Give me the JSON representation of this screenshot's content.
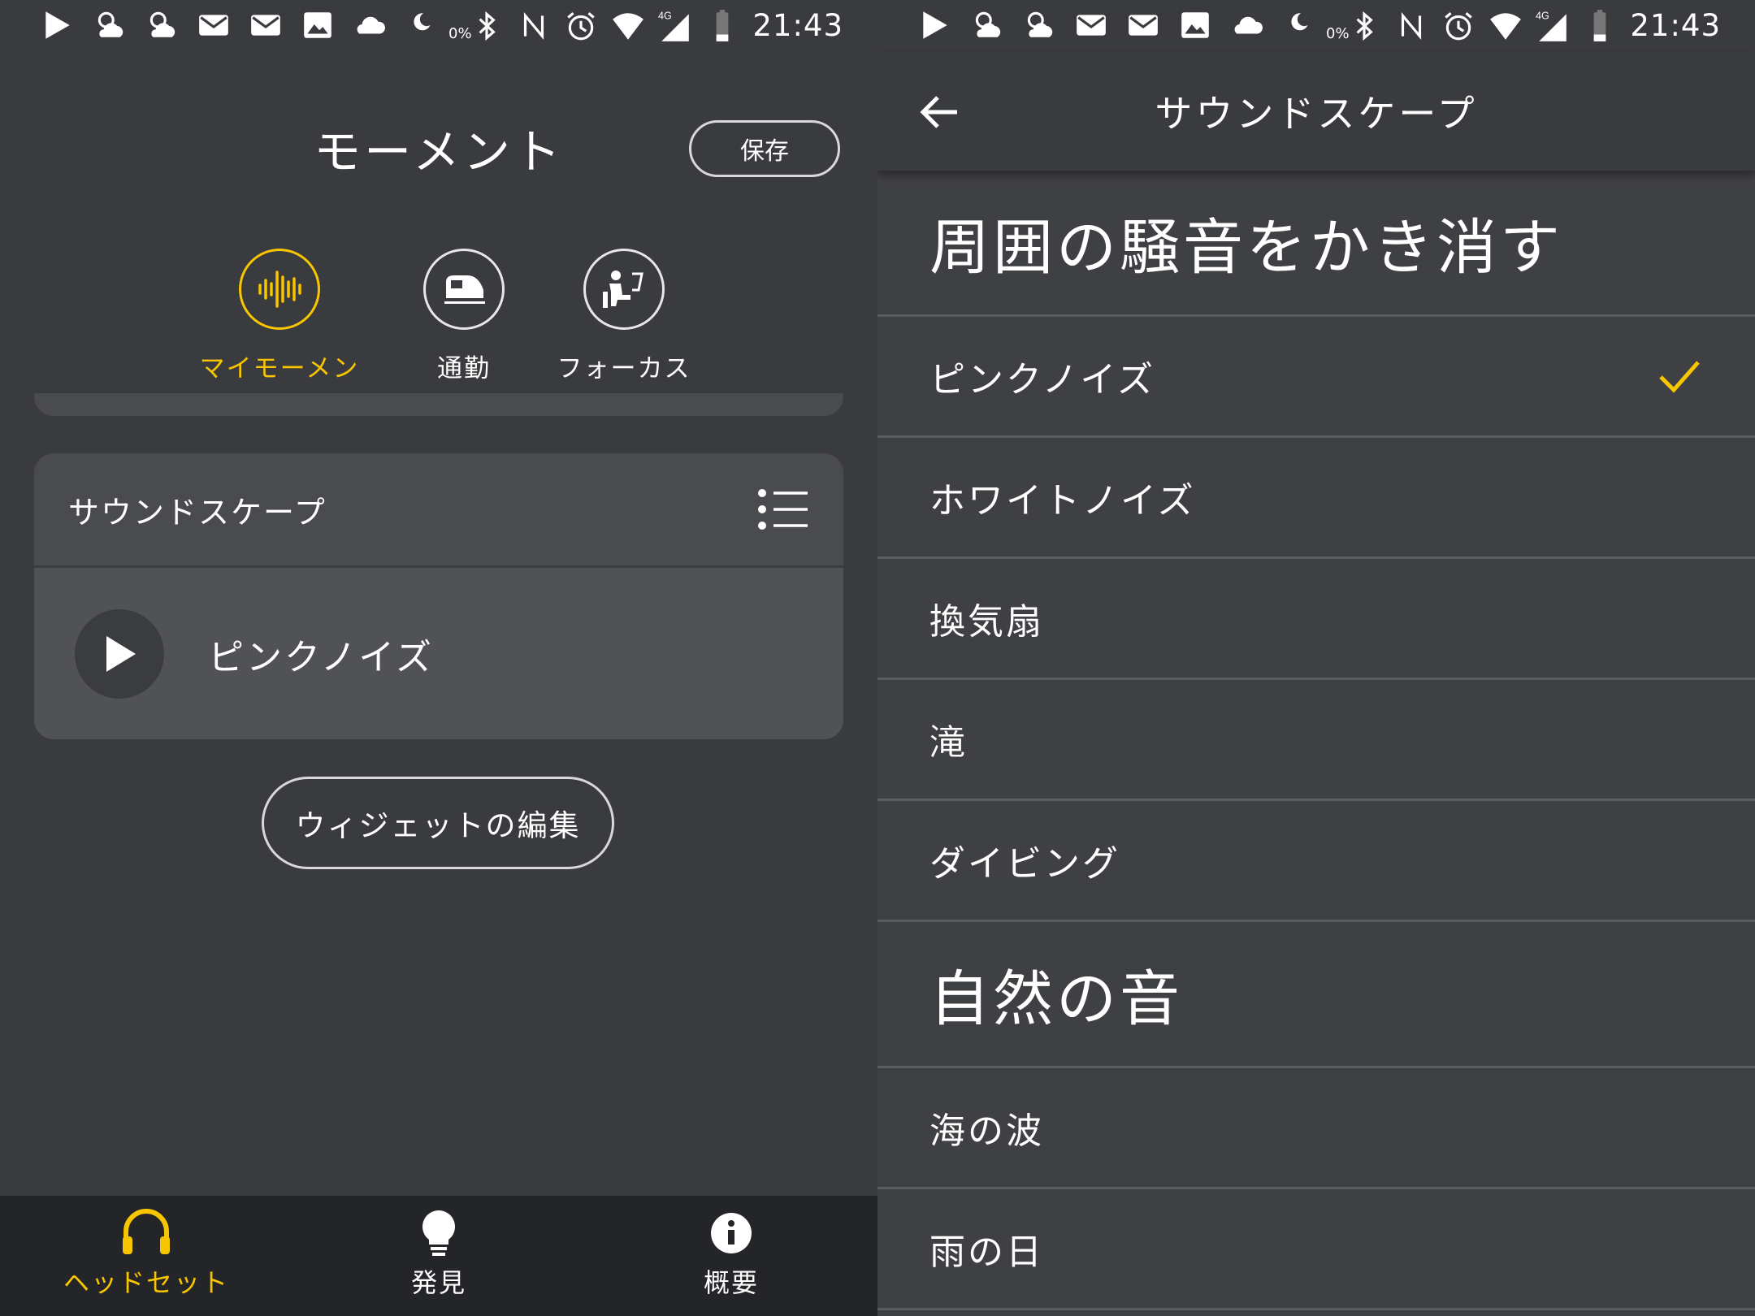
{
  "status_bar": {
    "time": "21:43",
    "battery_percent_label": "0%",
    "network": "4G"
  },
  "left": {
    "title": "モーメント",
    "save_label": "保存",
    "moments": [
      {
        "label": "マイモーメント",
        "icon": "sound-wave-icon",
        "active": true
      },
      {
        "label": "通勤",
        "icon": "train-icon",
        "active": false
      },
      {
        "label": "フォーカス",
        "icon": "desk-worker-icon",
        "active": false
      }
    ],
    "soundscape_card": {
      "title": "サウンドスケープ",
      "track": "ピンクノイズ"
    },
    "edit_widget_label": "ウィジェットの編集",
    "bottom_nav": [
      {
        "label": "ヘッドセット",
        "icon": "headphones-icon",
        "active": true
      },
      {
        "label": "発見",
        "icon": "lightbulb-icon",
        "active": false
      },
      {
        "label": "概要",
        "icon": "info-icon",
        "active": false
      }
    ]
  },
  "right": {
    "title": "サウンドスケープ",
    "sections": [
      {
        "heading": "周囲の騒音をかき消す",
        "items": [
          {
            "label": "ピンクノイズ",
            "selected": true
          },
          {
            "label": "ホワイトノイズ",
            "selected": false
          },
          {
            "label": "換気扇",
            "selected": false
          },
          {
            "label": "滝",
            "selected": false
          },
          {
            "label": "ダイビング",
            "selected": false
          }
        ]
      },
      {
        "heading": "自然の音",
        "items": [
          {
            "label": "海の波",
            "selected": false
          },
          {
            "label": "雨の日",
            "selected": false
          }
        ]
      }
    ]
  },
  "colors": {
    "accent": "#f7c600",
    "background": "#3a3b3e",
    "card": "#4a4b4f",
    "nav": "#242528"
  }
}
